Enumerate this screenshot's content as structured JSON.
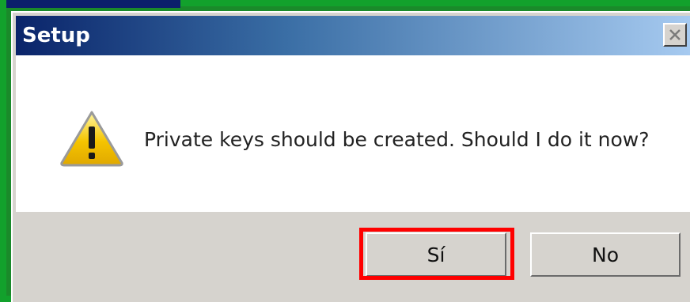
{
  "window": {
    "title": "Setup",
    "close_icon": "close-icon"
  },
  "message": {
    "icon": "warning-icon",
    "text": "Private keys should be created. Should I do it now?"
  },
  "buttons": {
    "yes_label": "Sí",
    "no_label": "No"
  },
  "colors": {
    "titlebar_start": "#0a246a",
    "titlebar_end": "#a6caf0",
    "dialog_bg": "#d6d3ce",
    "content_bg": "#ffffff",
    "highlight": "#ff0000",
    "outer_frame": "#12a12c"
  }
}
